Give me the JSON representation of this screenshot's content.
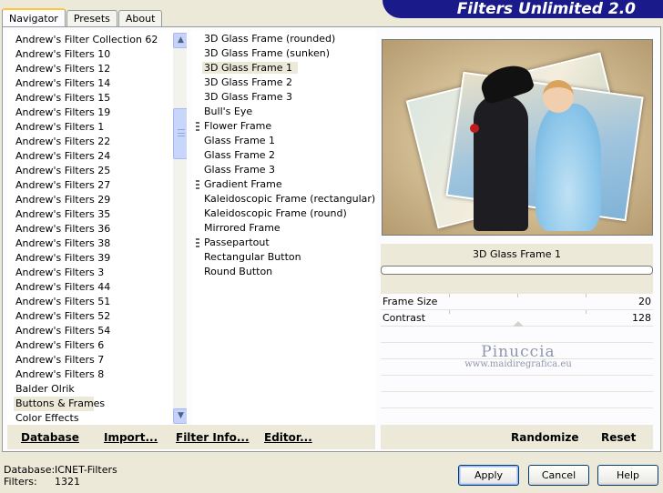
{
  "header": {
    "title": "Filters Unlimited 2.0"
  },
  "tabs": [
    {
      "label": "Navigator",
      "active": true
    },
    {
      "label": "Presets",
      "active": false
    },
    {
      "label": "About",
      "active": false
    }
  ],
  "categories": {
    "items": [
      "Andrew's Filter Collection 62",
      "Andrew's Filters 10",
      "Andrew's Filters 12",
      "Andrew's Filters 14",
      "Andrew's Filters 15",
      "Andrew's Filters 19",
      "Andrew's Filters 1",
      "Andrew's Filters 22",
      "Andrew's Filters 24",
      "Andrew's Filters 25",
      "Andrew's Filters 27",
      "Andrew's Filters 29",
      "Andrew's Filters 35",
      "Andrew's Filters 36",
      "Andrew's Filters 38",
      "Andrew's Filters 39",
      "Andrew's Filters 3",
      "Andrew's Filters 44",
      "Andrew's Filters 51",
      "Andrew's Filters 52",
      "Andrew's Filters 54",
      "Andrew's Filters 6",
      "Andrew's Filters 7",
      "Andrew's Filters 8",
      "Balder Olrik",
      "Buttons & Frames",
      "Color Effects"
    ],
    "selected": "Buttons & Frames",
    "scroll_up_glyph": "▲",
    "scroll_down_glyph": "▼"
  },
  "filters": {
    "items": [
      {
        "label": "3D Glass Frame (rounded)",
        "mark": false
      },
      {
        "label": "3D Glass Frame (sunken)",
        "mark": false
      },
      {
        "label": "3D Glass Frame 1",
        "mark": false,
        "selected": true
      },
      {
        "label": "3D Glass Frame 2",
        "mark": false
      },
      {
        "label": "3D Glass Frame 3",
        "mark": false
      },
      {
        "label": "Bull's Eye",
        "mark": false
      },
      {
        "label": "Flower Frame",
        "mark": true
      },
      {
        "label": "Glass Frame 1",
        "mark": false
      },
      {
        "label": "Glass Frame 2",
        "mark": false
      },
      {
        "label": "Glass Frame 3",
        "mark": false
      },
      {
        "label": "Gradient Frame",
        "mark": true
      },
      {
        "label": "Kaleidoscopic Frame (rectangular)",
        "mark": false
      },
      {
        "label": "Kaleidoscopic Frame (round)",
        "mark": false
      },
      {
        "label": "Mirrored Frame",
        "mark": false
      },
      {
        "label": "Passepartout",
        "mark": true
      },
      {
        "label": "Rectangular Button",
        "mark": false
      },
      {
        "label": "Round Button",
        "mark": false
      }
    ]
  },
  "filter_panel": {
    "name": "3D Glass Frame 1",
    "sliders": [
      {
        "label": "Frame Size",
        "value": "20"
      },
      {
        "label": "Contrast",
        "value": "128"
      }
    ],
    "watermark": {
      "line1": "Pinuccia",
      "line2": "www.maidiregrafica.eu"
    }
  },
  "left_buttons": {
    "database": "Database",
    "import": "Import...",
    "filter_info": "Filter Info...",
    "editor": "Editor..."
  },
  "right_buttons": {
    "randomize": "Randomize",
    "reset": "Reset"
  },
  "status": {
    "database_label": "Database:",
    "database_value": "ICNET-Filters",
    "filters_label": "Filters:",
    "filters_value": "1321"
  },
  "dialog": {
    "apply": "Apply",
    "cancel": "Cancel",
    "help": "Help"
  }
}
